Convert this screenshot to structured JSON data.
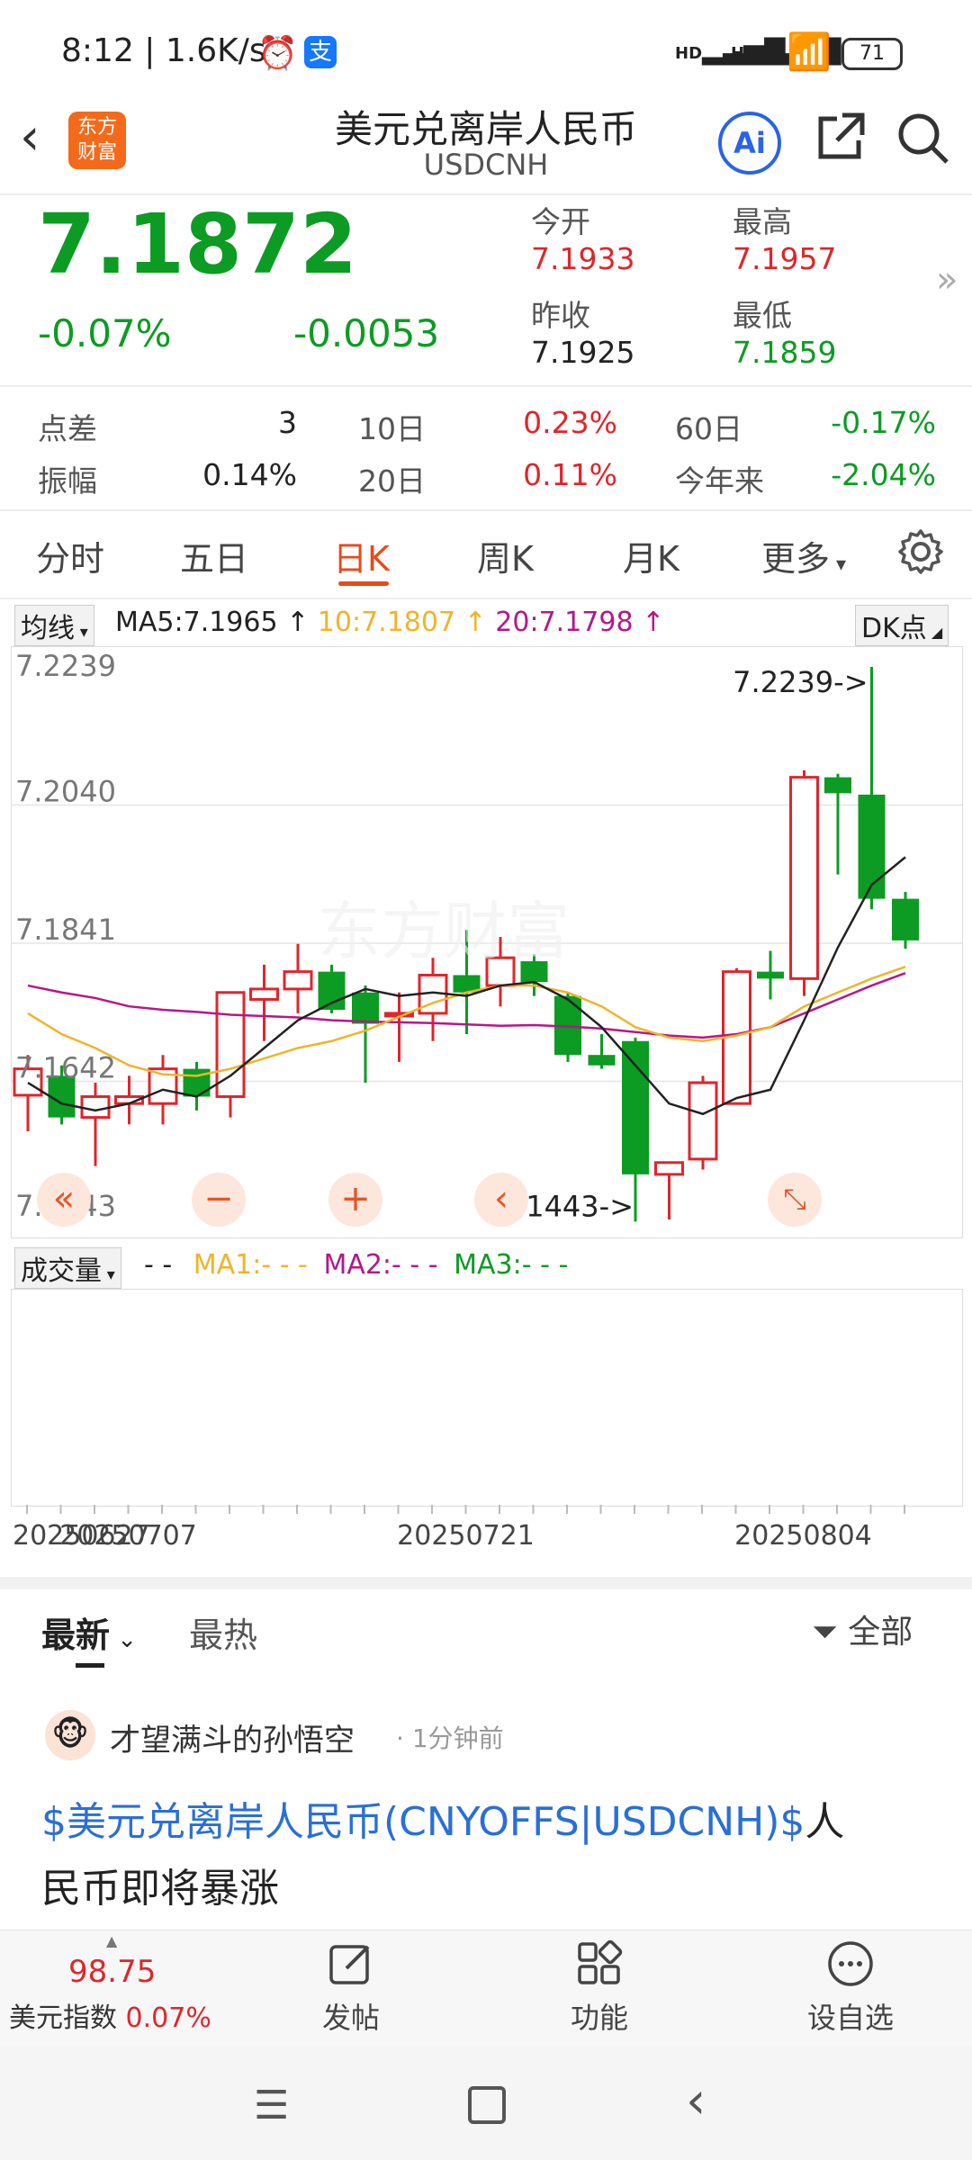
{
  "status": {
    "time": "8:12",
    "speed": "1.6K/s",
    "battery": "71",
    "net1": "HD",
    "net2": "HD"
  },
  "header": {
    "logo_text1": "东方",
    "logo_text2": "财富",
    "title": "美元兑离岸人民币",
    "subtitle": "USDCNH",
    "ai_label": "Ai"
  },
  "quote": {
    "price": "7.1872",
    "change_pct": "-0.07%",
    "change": "-0.0053",
    "open_label": "今开",
    "open": "7.1933",
    "high_label": "最高",
    "high": "7.1957",
    "prev_close_label": "昨收",
    "prev_close": "7.1925",
    "low_label": "最低",
    "low": "7.1859"
  },
  "stats": {
    "spread_label": "点差",
    "spread": "3",
    "amp_label": "振幅",
    "amp": "0.14%",
    "d10_label": "10日",
    "d10": "0.23%",
    "d20_label": "20日",
    "d20": "0.11%",
    "d60_label": "60日",
    "d60": "-0.17%",
    "ytd_label": "今年来",
    "ytd": "-2.04%"
  },
  "tabs": [
    "分时",
    "五日",
    "日K",
    "周K",
    "月K",
    "更多"
  ],
  "active_tab": 2,
  "chart_header": {
    "ma_select": "均线",
    "ma5": "MA5:7.1965",
    "ma10": "10:7.1807",
    "ma20": "20:7.1798",
    "dk": "DK点",
    "ma5_color": "#222222",
    "ma10_color": "#f0b429",
    "ma20_color": "#b5178a"
  },
  "chart_data": {
    "type": "candlestick",
    "y_ticks": [
      "7.2239",
      "7.2040",
      "7.1841",
      "7.1642",
      "7.1443"
    ],
    "ylim": [
      7.1443,
      7.2239
    ],
    "max_marker": "7.2239->",
    "min_marker": "7.1443->",
    "x_ticks": [
      "20250627",
      "20250707",
      "20250721",
      "20250804"
    ],
    "candles": [
      {
        "o": 7.1622,
        "h": 7.168,
        "l": 7.157,
        "c": 7.166
      },
      {
        "o": 7.165,
        "h": 7.1665,
        "l": 7.158,
        "c": 7.159
      },
      {
        "o": 7.159,
        "h": 7.164,
        "l": 7.152,
        "c": 7.162
      },
      {
        "o": 7.161,
        "h": 7.165,
        "l": 7.158,
        "c": 7.162
      },
      {
        "o": 7.161,
        "h": 7.168,
        "l": 7.158,
        "c": 7.166
      },
      {
        "o": 7.166,
        "h": 7.167,
        "l": 7.16,
        "c": 7.162
      },
      {
        "o": 7.162,
        "h": 7.177,
        "l": 7.159,
        "c": 7.177
      },
      {
        "o": 7.176,
        "h": 7.181,
        "l": 7.17,
        "c": 7.1775
      },
      {
        "o": 7.1775,
        "h": 7.184,
        "l": 7.174,
        "c": 7.18
      },
      {
        "o": 7.18,
        "h": 7.181,
        "l": 7.174,
        "c": 7.1745
      },
      {
        "o": 7.177,
        "h": 7.178,
        "l": 7.164,
        "c": 7.1725
      },
      {
        "o": 7.174,
        "h": 7.177,
        "l": 7.167,
        "c": 7.174
      },
      {
        "o": 7.174,
        "h": 7.182,
        "l": 7.17,
        "c": 7.1795
      },
      {
        "o": 7.1795,
        "h": 7.186,
        "l": 7.171,
        "c": 7.177
      },
      {
        "o": 7.178,
        "h": 7.185,
        "l": 7.175,
        "c": 7.182
      },
      {
        "o": 7.1815,
        "h": 7.1825,
        "l": 7.1765,
        "c": 7.1785
      },
      {
        "o": 7.1765,
        "h": 7.177,
        "l": 7.167,
        "c": 7.168
      },
      {
        "o": 7.168,
        "h": 7.171,
        "l": 7.166,
        "c": 7.1665
      },
      {
        "o": 7.17,
        "h": 7.1705,
        "l": 7.144,
        "c": 7.1508
      },
      {
        "o": 7.1508,
        "h": 7.152,
        "l": 7.1443,
        "c": 7.1525
      },
      {
        "o": 7.153,
        "h": 7.165,
        "l": 7.1515,
        "c": 7.164
      },
      {
        "o": 7.161,
        "h": 7.1805,
        "l": 7.161,
        "c": 7.18
      },
      {
        "o": 7.18,
        "h": 7.183,
        "l": 7.176,
        "c": 7.179
      },
      {
        "o": 7.179,
        "h": 7.209,
        "l": 7.1765,
        "c": 7.208
      },
      {
        "o": 7.208,
        "h": 7.2085,
        "l": 7.194,
        "c": 7.2057
      },
      {
        "o": 7.2055,
        "h": 7.2239,
        "l": 7.189,
        "c": 7.1905
      },
      {
        "o": 7.1905,
        "h": 7.1915,
        "l": 7.1833,
        "c": 7.1845
      }
    ],
    "ma5": [
      7.164,
      7.161,
      7.16,
      7.161,
      7.163,
      7.162,
      7.165,
      7.169,
      7.173,
      7.1755,
      7.1775,
      7.1765,
      7.177,
      7.1765,
      7.178,
      7.1785,
      7.176,
      7.172,
      7.1665,
      7.161,
      7.1595,
      7.1618,
      7.163,
      7.173,
      7.1835,
      7.1925,
      7.1965
    ],
    "ma10": [
      7.174,
      7.171,
      7.169,
      7.1665,
      7.1652,
      7.165,
      7.166,
      7.1675,
      7.169,
      7.17,
      7.1715,
      7.1735,
      7.1755,
      7.177,
      7.178,
      7.178,
      7.177,
      7.175,
      7.172,
      7.1705,
      7.17,
      7.1708,
      7.172,
      7.175,
      7.177,
      7.179,
      7.1807
    ],
    "ma20": [
      7.178,
      7.177,
      7.1762,
      7.175,
      7.1745,
      7.1742,
      7.1738,
      7.1736,
      7.1734,
      7.173,
      7.1728,
      7.1727,
      7.1726,
      7.1724,
      7.1722,
      7.1723,
      7.1721,
      7.1718,
      7.1713,
      7.1708,
      7.1705,
      7.171,
      7.172,
      7.174,
      7.176,
      7.178,
      7.1798
    ]
  },
  "volume": {
    "select": "成交量",
    "dash": "- -",
    "ma1": "MA1:- - -",
    "ma2": "MA2:- - -",
    "ma3": "MA3:- - -",
    "ma1_color": "#f0b429",
    "ma2_color": "#b5178a",
    "ma3_color": "#0c9b23"
  },
  "feed": {
    "tab_latest": "最新",
    "tab_hot": "最热",
    "filter": "全部",
    "author": "才望满斗的孙悟空",
    "time": "1分钟前",
    "post_link": "$美元兑离岸人民币(CNYOFFS|USDCNH)$",
    "post_rest1": "人",
    "post_rest2": "民币即将暴涨"
  },
  "bottom": {
    "index_value": "98.75",
    "index_name": "美元指数",
    "index_change": "0.07%",
    "post_label": "发帖",
    "func_label": "功能",
    "watch_label": "设自选"
  }
}
